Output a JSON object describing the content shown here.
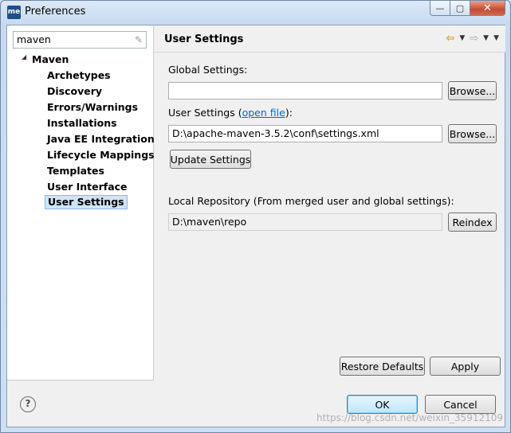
{
  "window": {
    "title": "Preferences",
    "app_icon": "me",
    "minimize_glyph": "—",
    "maximize_glyph": "▢",
    "close_glyph": "✕"
  },
  "sidebar": {
    "filter_value": "maven",
    "clear_icon": "eraser-icon",
    "root": {
      "label": "Maven",
      "expanded": true
    },
    "items": [
      {
        "label": "Archetypes"
      },
      {
        "label": "Discovery"
      },
      {
        "label": "Errors/Warnings"
      },
      {
        "label": "Installations"
      },
      {
        "label": "Java EE Integration"
      },
      {
        "label": "Lifecycle Mappings"
      },
      {
        "label": "Templates"
      },
      {
        "label": "User Interface"
      },
      {
        "label": "User Settings",
        "selected": true
      }
    ]
  },
  "page": {
    "title": "User Settings",
    "nav": {
      "back": "⇦",
      "forward": "⇨",
      "dropdown": "▼",
      "menu": "▼"
    },
    "global_settings_label": "Global Settings:",
    "global_settings_value": "",
    "browse_label": "Browse...",
    "user_settings_label": "User Settings (",
    "open_file_link": "open file",
    "user_settings_label_end": "):",
    "user_settings_value": "D:\\apache-maven-3.5.2\\conf\\settings.xml",
    "update_settings_label": "Update Settings",
    "local_repo_label": "Local Repository (From merged user and global settings):",
    "local_repo_value": "D:\\maven\\repo",
    "reindex_label": "Reindex",
    "restore_defaults_label": "Restore Defaults",
    "apply_label": "Apply"
  },
  "footer": {
    "help_glyph": "?",
    "ok_label": "OK",
    "cancel_label": "Cancel",
    "watermark": "https://blog.csdn.net/weixin_35912109"
  }
}
